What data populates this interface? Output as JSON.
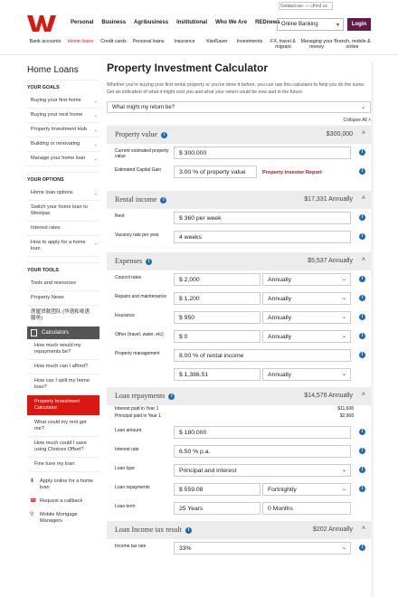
{
  "header": {
    "toplinks": [
      "Contact us",
      "Find us"
    ],
    "search_placeholder": "How can we help?",
    "main_nav": [
      "Personal",
      "Business",
      "Agribusiness",
      "Institutional",
      "Who We Are",
      "REDnews"
    ],
    "online_banking": "Online Banking",
    "login": "Login",
    "sub_nav": [
      {
        "label": "Bank accounts"
      },
      {
        "label": "Home loans",
        "active": true
      },
      {
        "label": "Credit cards"
      },
      {
        "label": "Personal loans"
      },
      {
        "label": "Insurance"
      },
      {
        "label": "KiwiSaver"
      },
      {
        "label": "Investments"
      },
      {
        "label": "FX, travel & migrant"
      },
      {
        "label": "Managing your money"
      },
      {
        "label": "Branch, mobile & online"
      }
    ],
    "brand_color": "#da1710"
  },
  "sidebar": {
    "title": "Home Loans",
    "your_goals_head": "YOUR GOALS",
    "goals": [
      "Buying your first home",
      "Buying your next home",
      "Property Investment Hub",
      "Building or renovating",
      "Manage your home loan"
    ],
    "your_options_head": "YOUR OPTIONS",
    "options": [
      "Home loan options",
      "Switch your home loan to Westpac",
      "Interest rates",
      "How to apply for a home loan"
    ],
    "your_tools_head": "YOUR TOOLS",
    "tools": [
      "Tools and resources",
      "Property News",
      "房屋贷款团队 (华语和粤语 服务)"
    ],
    "calculators_label": "Calculators",
    "calculators": [
      "How much would my repayments be?",
      "How much can I afford?",
      "How can I split my home loan?",
      "Property Investment Calculator",
      "What could my rent get me?",
      "How much could I save using Choices Offset?",
      "Fine tune my loan"
    ],
    "active_calculator": "Property Investment Calculator",
    "links": [
      {
        "icon": "download-icon",
        "label": "Apply online for a home loan"
      },
      {
        "icon": "phone-icon",
        "label": "Request a callback"
      },
      {
        "icon": "location-pin-icon",
        "label": "Mobile Mortgage Managers"
      }
    ]
  },
  "main": {
    "title": "Property Investment Calculator",
    "intro": "Whether you're buying your first rental property or you've done it before, you can use this calculator to help you do the sums. Get an indication of what it might cost you and what your return could be now and in the future.",
    "return_select": "What might my return be?",
    "collapse_all": "Collapse All",
    "property_value": {
      "title": "Property value",
      "total": "$300,000",
      "current_label": "Current estimated property value",
      "current_value": "$ 300,000",
      "gain_label": "Estimated Capital Gain",
      "gain_value": "3.00 % of property value",
      "report_link": "Property Investor Report"
    },
    "rental_income": {
      "title": "Rental income",
      "total": "$17,331 Annually",
      "rent_label": "Rent",
      "rent_value": "$ 360 per week",
      "vacancy_label": "Vacancy rate per year",
      "vacancy_value": "4 weeks"
    },
    "expenses": {
      "title": "Expenses",
      "total": "$5,537 Annually",
      "items": [
        {
          "label": "Council rates",
          "value": "$ 2,000",
          "freq": "Annually"
        },
        {
          "label": "Repairs and maintenance",
          "value": "$ 1,200",
          "freq": "Annually"
        },
        {
          "label": "Insurance",
          "value": "$ 950",
          "freq": "Annually"
        },
        {
          "label": "Other (travel, water, etc)",
          "value": "$ 0",
          "freq": "Annually"
        }
      ],
      "mgmt_label": "Property management",
      "mgmt_pct": "8.00 % of rental income",
      "mgmt_value": "$ 1,386.51",
      "mgmt_freq": "Annually"
    },
    "loan_repayments": {
      "title": "Loan repayments",
      "total": "$14,576 Annually",
      "interest_label": "Interest paid in Year 1",
      "interest_value": "$11,608",
      "principal_label": "Principal paid in Year 1",
      "principal_value": "$2,968",
      "amount_label": "Loan amount",
      "amount_value": "$ 180,000",
      "rate_label": "Interest rate",
      "rate_value": "6.50 % p.a.",
      "type_label": "Loan type",
      "type_value": "Principal and interest",
      "repay_label": "Loan repayments",
      "repay_value": "$ 559.08",
      "repay_freq": "Fortnightly",
      "term_label": "Loan term",
      "term_years": "25 Years",
      "term_months": "0 Months"
    },
    "tax": {
      "title": "Loan Income tax result",
      "total": "$202 Annually",
      "rate_label": "Income tax rate",
      "rate_value": "33%"
    }
  }
}
